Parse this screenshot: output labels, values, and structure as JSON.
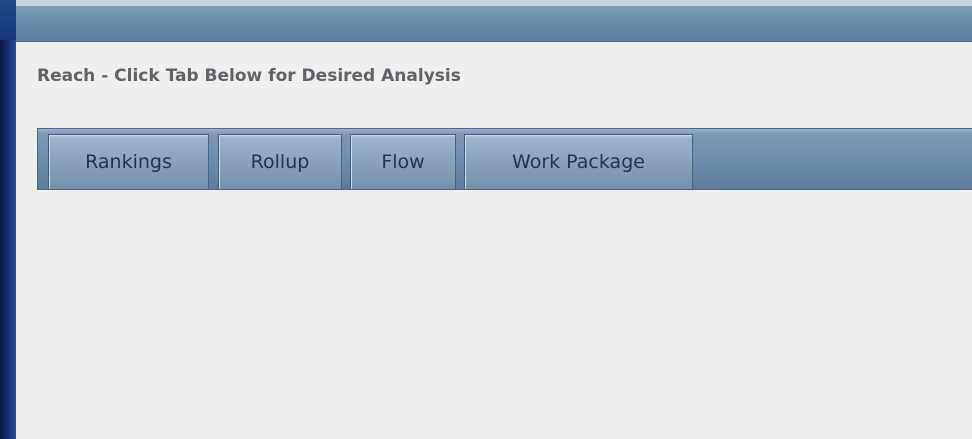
{
  "heading": "Reach - Click Tab Below for Desired Analysis",
  "tabs": [
    {
      "label": "Rankings"
    },
    {
      "label": "Rollup"
    },
    {
      "label": "Flow"
    },
    {
      "label": "Work Package"
    }
  ],
  "colors": {
    "background": "#efefef",
    "titlebar": "#6f8ca9",
    "tabbar": "#6d8aa7",
    "tab": "#8aa3bb",
    "heading_text": "#5f6266",
    "tab_text": "#243648"
  }
}
